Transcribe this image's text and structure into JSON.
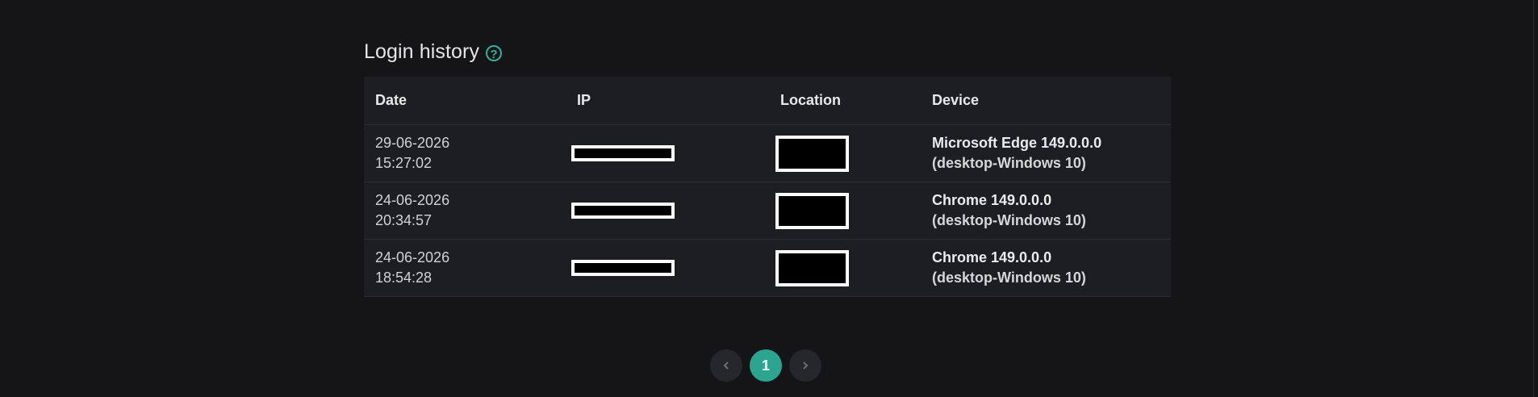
{
  "section": {
    "title": "Login history",
    "help_icon": "question-circle-icon"
  },
  "table": {
    "headers": {
      "date": "Date",
      "ip": "IP",
      "location": "Location",
      "device": "Device"
    },
    "rows": [
      {
        "date": "29-06-2026",
        "time": "15:27:02",
        "device_name": "Microsoft Edge 149.0.0.0",
        "device_detail": "(desktop-Windows 10)"
      },
      {
        "date": "24-06-2026",
        "time": "20:34:57",
        "device_name": "Chrome 149.0.0.0",
        "device_detail": "(desktop-Windows 10)"
      },
      {
        "date": "24-06-2026",
        "time": "18:54:28",
        "device_name": "Chrome 149.0.0.0",
        "device_detail": "(desktop-Windows 10)"
      }
    ]
  },
  "pagination": {
    "current_page": "1",
    "prev_icon": "chevron-left-icon",
    "next_icon": "chevron-right-icon"
  },
  "colors": {
    "accent": "#2aa590",
    "background": "#151518",
    "table_background": "#1d1e22"
  }
}
